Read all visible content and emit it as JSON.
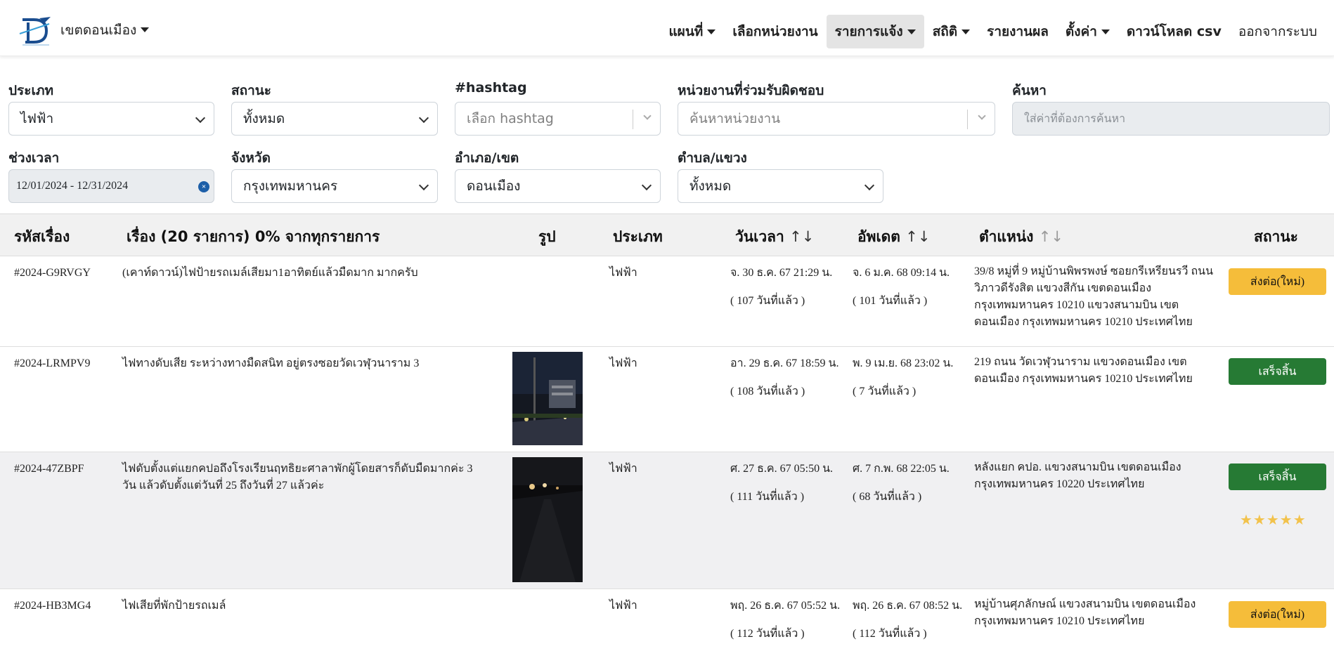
{
  "navbar": {
    "brand": "เขตดอนเมือง",
    "items": [
      {
        "label": "แผนที่",
        "dropdown": true
      },
      {
        "label": "เลือกหน่วยงาน",
        "dropdown": false
      },
      {
        "label": "รายการแจ้ง",
        "dropdown": true,
        "active": true
      },
      {
        "label": "สถิติ",
        "dropdown": true
      },
      {
        "label": "รายงานผล",
        "dropdown": false
      },
      {
        "label": "ตั้งค่า",
        "dropdown": true
      },
      {
        "label": "ดาวน์โหลด csv",
        "dropdown": false
      },
      {
        "label": "ออกจากระบบ",
        "dropdown": false
      }
    ]
  },
  "filters": {
    "type": {
      "label": "ประเภท",
      "value": "ไฟฟ้า"
    },
    "status": {
      "label": "สถานะ",
      "value": "ทั้งหมด"
    },
    "hashtag": {
      "label": "#hashtag",
      "placeholder": "เลือก hashtag"
    },
    "agency": {
      "label": "หน่วยงานที่ร่วมรับผิดชอบ",
      "placeholder": "ค้นหาหน่วยงาน"
    },
    "search": {
      "label": "ค้นหา",
      "placeholder": "ใส่ค่าที่ต้องการค้นหา"
    },
    "period": {
      "label": "ช่วงเวลา",
      "value": "12/01/2024 - 12/31/2024"
    },
    "province": {
      "label": "จังหวัด",
      "value": "กรุงเทพมหานคร"
    },
    "district": {
      "label": "อำเภอ/เขต",
      "value": "ดอนเมือง"
    },
    "subdistrict": {
      "label": "ตำบล/แขวง",
      "value": "ทั้งหมด"
    }
  },
  "table": {
    "headers": {
      "code": "รหัสเรื่อง",
      "subject": "เรื่อง (20 รายการ) 0% จากทุกรายการ",
      "image": "รูป",
      "type": "ประเภท",
      "datetime": "วันเวลา",
      "updated": "อัพเดต",
      "location": "ตำแหน่ง",
      "status": "สถานะ",
      "sort_icon": "↑↓"
    },
    "rows": [
      {
        "code": "#2024-G9RVGY",
        "subject": "(เคาท์ดาวน์)ไฟป้ายรถเมล์เสียมา1อาทิตย์แล้วมืดมาก มากครับ",
        "type": "ไฟฟ้า",
        "datetime": "จ. 30 ธ.ค. 67 21:29 น.",
        "datetime_ago": "( 107 วันที่แล้ว )",
        "updated": "จ. 6 ม.ค. 68 09:14 น.",
        "updated_ago": "( 101 วันที่แล้ว )",
        "location": "39/8 หมู่ที่ 9 หมู่บ้านพิพรพงษ์ ซอยกรีเหรียนรวี ถนนวิภาวดีรังสิต แขวงสีกัน เขตดอนเมือง กรุงเทพมหานคร 10210 แขวงสนามบิน เขตดอนเมือง กรุงเทพมหานคร 10210 ประเทศไทย",
        "status": "ส่งต่อ(ใหม่)",
        "status_color": "#f5bd3a"
      },
      {
        "code": "#2024-LRMPV9",
        "subject": "ไฟทางดับเสีย ระหว่างทางมืดสนิท อยู่ตรงซอยวัดเวฬุวนาราม 3",
        "type": "ไฟฟ้า",
        "datetime": "อา. 29 ธ.ค. 67 18:59 น.",
        "datetime_ago": "( 108 วันที่แล้ว )",
        "updated": "พ. 9 เม.ย. 68 23:02 น.",
        "updated_ago": "( 7 วันที่แล้ว )",
        "location": "219 ถนน วัดเวฬุวนาราม แขวงดอนเมือง เขตดอนเมือง กรุงเทพมหานคร 10210 ประเทศไทย",
        "status": "เสร็จสิ้น",
        "status_color": "#267a34"
      },
      {
        "code": "#2024-47ZBPF",
        "subject": "ไฟดับตั้งแต่แยกคปอถึงโรงเรียนฤทธิยะศาลาพักผู้โดยสารก็ดับมืดมากค่ะ 3 วัน แล้วดับตั้งแต่วันที่ 25 ถึงวันที่ 27 แล้วค่ะ",
        "type": "ไฟฟ้า",
        "datetime": "ศ. 27 ธ.ค. 67 05:50 น.",
        "datetime_ago": "( 111 วันที่แล้ว )",
        "updated": "ศ. 7 ก.พ. 68 22:05 น.",
        "updated_ago": "( 68 วันที่แล้ว )",
        "location": "หลังแยก คปอ. แขวงสนามบิน เขตดอนเมือง กรุงเทพมหานคร 10220 ประเทศไทย",
        "status": "เสร็จสิ้น",
        "status_color": "#267a34",
        "rating": "★★★★★"
      },
      {
        "code": "#2024-HB3MG4",
        "subject": "ไฟเสียที่พักป้ายรถเมล์",
        "type": "ไฟฟ้า",
        "datetime": "พฤ. 26 ธ.ค. 67 05:52 น.",
        "datetime_ago": "( 112 วันที่แล้ว )",
        "updated": "พฤ. 26 ธ.ค. 67 08:52 น.",
        "updated_ago": "( 112 วันที่แล้ว )",
        "location": "หมู่บ้านศุภลักษณ์ แขวงสนามบิน เขตดอนเมือง กรุงเทพมหานคร 10210 ประเทศไทย",
        "status": "ส่งต่อ(ใหม่)",
        "status_color": "#f5bd3a"
      }
    ]
  }
}
